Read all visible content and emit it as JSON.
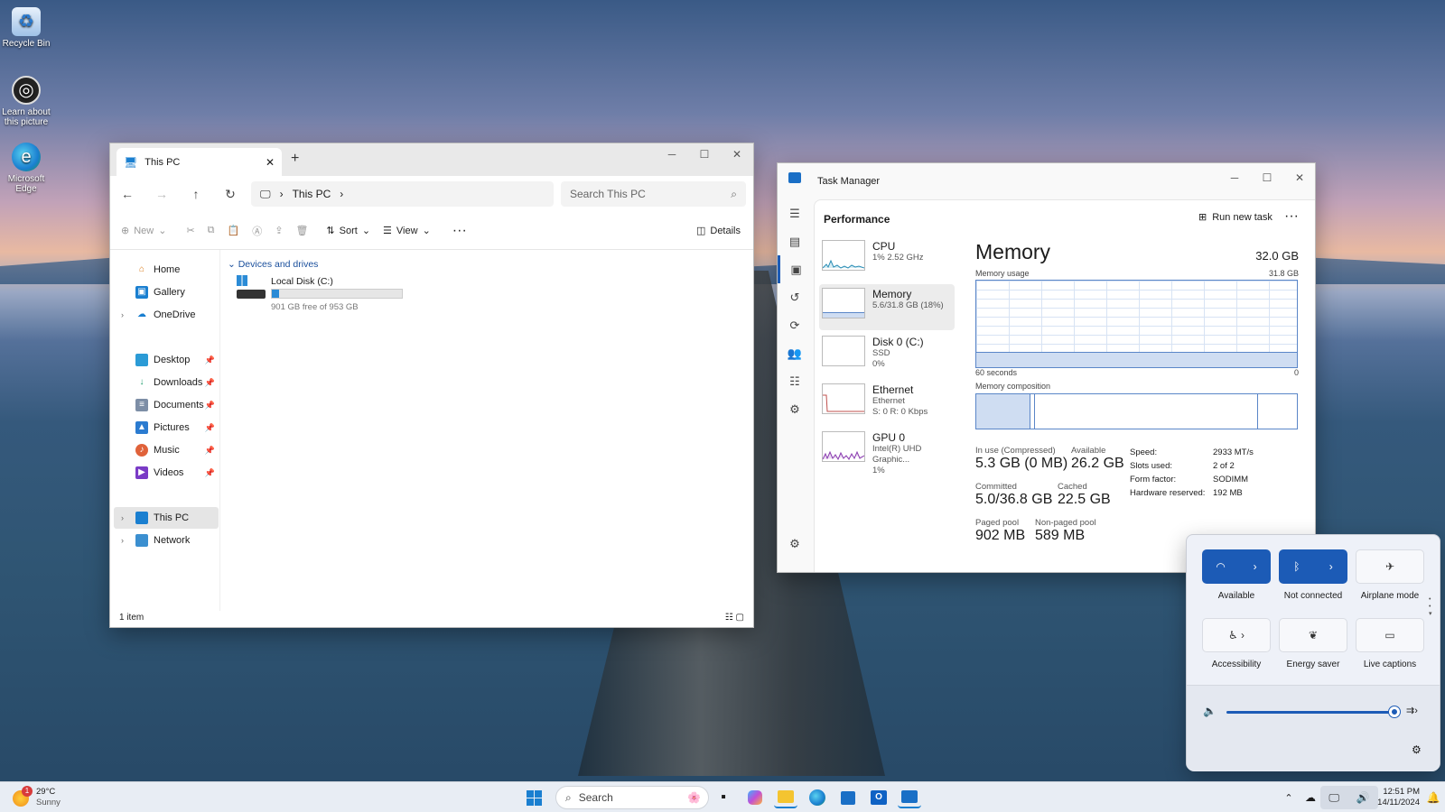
{
  "desktop": {
    "icons": [
      {
        "label": "Recycle Bin",
        "icon": "recycle-bin-icon"
      },
      {
        "label": "Learn about this picture",
        "icon": "learn-picture-icon"
      },
      {
        "label": "Microsoft Edge",
        "icon": "edge-icon"
      }
    ]
  },
  "explorer": {
    "tab_title": "This PC",
    "address": "This PC",
    "search_placeholder": "Search This PC",
    "cmd": {
      "new": "New",
      "sort": "Sort",
      "view": "View",
      "details": "Details"
    },
    "nav": {
      "home": "Home",
      "gallery": "Gallery",
      "onedrive": "OneDrive",
      "desktop": "Desktop",
      "downloads": "Downloads",
      "documents": "Documents",
      "pictures": "Pictures",
      "music": "Music",
      "videos": "Videos",
      "thispc": "This PC",
      "network": "Network"
    },
    "section": "Devices and drives",
    "drive": {
      "name": "Local Disk (C:)",
      "free": "901 GB free of 953 GB",
      "used_fraction": 0.055
    },
    "status": "1 item"
  },
  "taskmgr": {
    "title": "Task Manager",
    "heading": "Performance",
    "run_new_task": "Run new task",
    "items": [
      {
        "name": "CPU",
        "sub1": "1% 2.52 GHz",
        "sub2": ""
      },
      {
        "name": "Memory",
        "sub1": "5.6/31.8 GB (18%)",
        "sub2": ""
      },
      {
        "name": "Disk 0 (C:)",
        "sub1": "SSD",
        "sub2": "0%"
      },
      {
        "name": "Ethernet",
        "sub1": "Ethernet",
        "sub2": "S: 0 R: 0 Kbps"
      },
      {
        "name": "GPU 0",
        "sub1": "Intel(R) UHD Graphic...",
        "sub2": "1%"
      }
    ],
    "memory": {
      "title": "Memory",
      "total": "32.0 GB",
      "usage_label": "Memory usage",
      "usage_max": "31.8 GB",
      "axis_left": "60 seconds",
      "axis_right": "0",
      "composition_label": "Memory composition",
      "stats": {
        "in_use_k": "In use (Compressed)",
        "in_use_v": "5.3 GB (0 MB)",
        "available_k": "Available",
        "available_v": "26.2 GB",
        "committed_k": "Committed",
        "committed_v": "5.0/36.8 GB",
        "cached_k": "Cached",
        "cached_v": "22.5 GB",
        "paged_k": "Paged pool",
        "paged_v": "902 MB",
        "nonpaged_k": "Non-paged pool",
        "nonpaged_v": "589 MB"
      },
      "specs": [
        {
          "k": "Speed:",
          "v": "2933 MT/s"
        },
        {
          "k": "Slots used:",
          "v": "2 of 2"
        },
        {
          "k": "Form factor:",
          "v": "SODIMM"
        },
        {
          "k": "Hardware reserved:",
          "v": "192 MB"
        }
      ]
    }
  },
  "quick_settings": {
    "tiles": [
      {
        "label": "Available",
        "icon": "wifi-icon",
        "on": true
      },
      {
        "label": "Not connected",
        "icon": "bluetooth-icon",
        "on": true
      },
      {
        "label": "Airplane mode",
        "icon": "airplane-icon",
        "on": false
      },
      {
        "label": "Accessibility",
        "icon": "accessibility-icon",
        "on": false
      },
      {
        "label": "Energy saver",
        "icon": "energy-saver-icon",
        "on": false
      },
      {
        "label": "Live captions",
        "icon": "captions-icon",
        "on": false
      }
    ],
    "volume_percent": 98
  },
  "taskbar": {
    "weather_temp": "29°C",
    "weather_desc": "Sunny",
    "weather_badge": "1",
    "search_label": "Search",
    "time": "12:51 PM",
    "date": "14/11/2024"
  },
  "colors": {
    "accent": "#1c5bb6",
    "graph_line": "#5a86c8"
  }
}
